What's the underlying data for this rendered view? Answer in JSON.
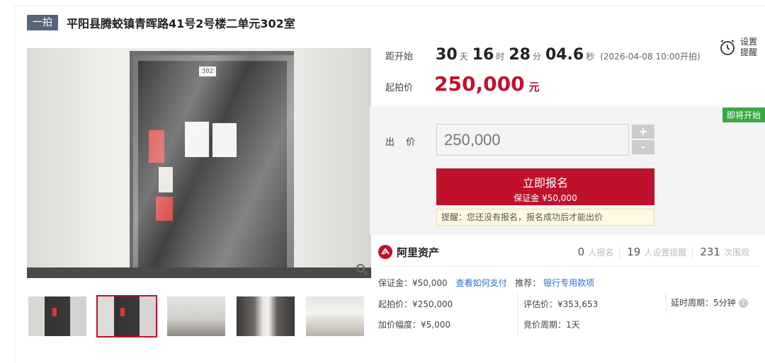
{
  "header": {
    "badge": "一拍",
    "title": "平阳县腾蛟镇青晖路41号2号楼二单元302室"
  },
  "gallery": {
    "door_number": "302",
    "thumbnails": [
      "door-photo-1",
      "door-photo-2",
      "room-photo-1",
      "room-photo-2",
      "room-photo-3"
    ],
    "active_index": 1
  },
  "countdown": {
    "label": "距开始",
    "days": "30",
    "days_unit": "天",
    "hours": "16",
    "hours_unit": "时",
    "minutes": "28",
    "minutes_unit": "分",
    "seconds": "04.6",
    "seconds_unit": "秒",
    "start_text": "(2026-04-08 10:00开拍)"
  },
  "reminder": {
    "label": "设置提醒"
  },
  "start_price": {
    "label": "起拍价",
    "value": "250,000",
    "unit": "元"
  },
  "bid": {
    "soon_tag": "即将开始",
    "label": "出 价",
    "value": "250,000",
    "plus": "+",
    "minus": "-",
    "signup_label": "立即报名",
    "deposit_label": "保证金 ¥50,000",
    "notice": "提醒：您还没有报名，报名成功后才能出价"
  },
  "platform": {
    "name": "阿里资产",
    "signups": "0",
    "signups_label": "人报名",
    "reminders": "19",
    "reminders_label": "人设置提醒",
    "views": "231",
    "views_label": "次围观"
  },
  "details": {
    "deposit": "保证金：¥50,000",
    "pay_link": "查看如何支付",
    "recommend": "推荐：",
    "bank_link": "银行专用款项",
    "start_price": "起拍价：¥250,000",
    "appraisal": "评估价：¥353,653",
    "delay": "延时周期：5分钟",
    "increment": "加价幅度：¥5,000",
    "cycle": "竞价周期：1天"
  },
  "colors": {
    "accent": "#c0112c",
    "link": "#2b6fcc",
    "badge": "#56657a",
    "soon": "#3aa745"
  }
}
